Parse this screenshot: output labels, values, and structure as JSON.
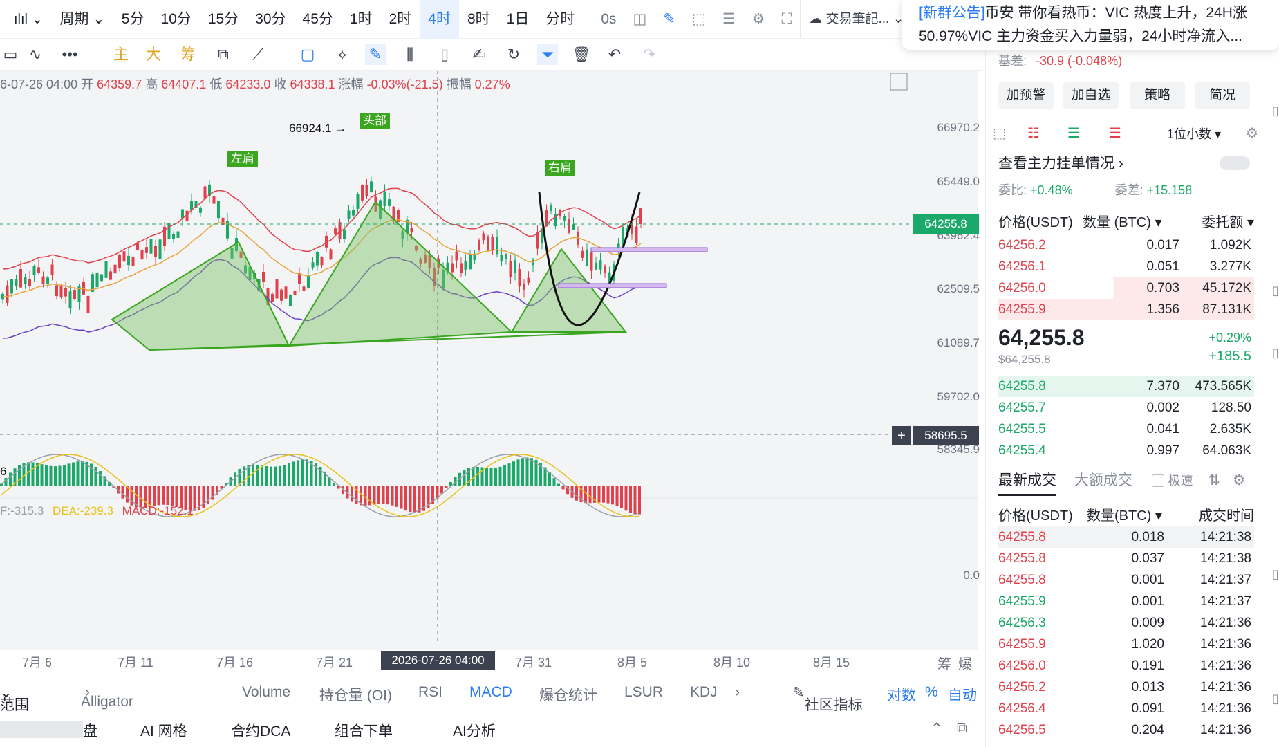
{
  "topbar": {
    "period_label": "周期",
    "intervals": [
      "5分",
      "10分",
      "15分",
      "30分",
      "45分",
      "1时",
      "2时",
      "4时",
      "8时",
      "1日",
      "分时"
    ],
    "active_interval": "4时",
    "countdown": "0s",
    "notes_label": "交易筆記..."
  },
  "toolbar2": {
    "main": "主",
    "big": "大",
    "chip": "筹"
  },
  "ohlc": {
    "datetime": "6-07-26 04:00",
    "open_label": "开",
    "open": "64359.7",
    "high_label": "高",
    "high": "64407.1",
    "low_label": "低",
    "low": "64233.0",
    "close_label": "收",
    "close": "64338.1",
    "change_label": "涨幅",
    "change": "-0.03%(-21.5)",
    "amp_label": "振幅",
    "amp": "0.27%"
  },
  "chart_data": {
    "type": "candlestick",
    "y_ticks": [
      "66970.2",
      "65449.0",
      "63962.4",
      "62509.5",
      "61089.7",
      "59702.0",
      "58345.9"
    ],
    "current_price_tag": "64255.8",
    "crosshair_price_tag": "58695.5",
    "crosshair_date_tag": "2026-07-26 04:00",
    "x_ticks": [
      "7月 6",
      "7月 11",
      "7月 16",
      "7月 21",
      "7月 31",
      "8月 5",
      "8月 10",
      "8月 15"
    ],
    "annotations": {
      "high_marker": "66924.1 →",
      "left_shoulder": "左肩",
      "head": "头部",
      "right_shoulder": "右肩",
      "low_marker": "6"
    },
    "macd": {
      "dif": "F:-315.3",
      "dea": "DEA:-239.3",
      "macd": "MACD:-152.1",
      "zero": "0.0"
    },
    "corner_labels": [
      "筹",
      "爆"
    ]
  },
  "bottom_tabs": {
    "range": "范围",
    "alligator": "Alligator",
    "items": [
      "Volume",
      "持仓量 (OI)",
      "RSI",
      "MACD",
      "爆仓统计",
      "LSUR",
      "KDJ"
    ],
    "active": "MACD",
    "community": "社区指标",
    "log": "对数",
    "pct": "%",
    "auto": "自动"
  },
  "footer": {
    "items": [
      "盘",
      "AI 网格",
      "合约DCA",
      "组合下单",
      "AI分析"
    ]
  },
  "notification": {
    "line1_tag": "[新群公告]",
    "line1": "币安 带你看热币：VIC 热度上升，24H涨",
    "line2": "50.97%VIC 主力资金买入力量弱，24小时净流入..."
  },
  "right_panel": {
    "basis_label": "基差:",
    "basis_value": "-30.9 (-0.048%)",
    "buttons": [
      "加预警",
      "加自选",
      "策略",
      "简况"
    ],
    "decimals": "1位小数",
    "main_orders": "查看主力挂单情况",
    "weibi_label": "委比:",
    "weibi": "+0.48%",
    "weicha_label": "委差:",
    "weicha": "+15.158",
    "ob_headers": {
      "price": "价格(USDT)",
      "qty": "数量 (BTC)",
      "amount": "委托额"
    },
    "asks": [
      {
        "p": "64256.2",
        "q": "0.017",
        "t": "1.092K"
      },
      {
        "p": "64256.1",
        "q": "0.051",
        "t": "3.277K"
      },
      {
        "p": "64256.0",
        "q": "0.703",
        "t": "45.172K"
      },
      {
        "p": "64255.9",
        "q": "1.356",
        "t": "87.131K"
      }
    ],
    "last_price": "64,255.8",
    "last_usd": "$64,255.8",
    "last_pct": "+0.29%",
    "last_chg": "+185.5",
    "bids": [
      {
        "p": "64255.8",
        "q": "7.370",
        "t": "473.565K"
      },
      {
        "p": "64255.7",
        "q": "0.002",
        "t": "128.50"
      },
      {
        "p": "64255.5",
        "q": "0.041",
        "t": "2.635K"
      },
      {
        "p": "64255.4",
        "q": "0.997",
        "t": "64.063K"
      }
    ],
    "trades_tab": "最新成交",
    "big_trades_tab": "大额成交",
    "fast_label": "极速",
    "trade_headers": {
      "price": "价格(USDT)",
      "qty": "数量(BTC)",
      "time": "成交时间"
    },
    "trades": [
      {
        "p": "64255.8",
        "q": "0.018",
        "t": "14:21:38",
        "side": "red"
      },
      {
        "p": "64255.8",
        "q": "0.037",
        "t": "14:21:38",
        "side": "red"
      },
      {
        "p": "64255.8",
        "q": "0.001",
        "t": "14:21:37",
        "side": "red"
      },
      {
        "p": "64255.9",
        "q": "0.001",
        "t": "14:21:37",
        "side": "green"
      },
      {
        "p": "64256.3",
        "q": "0.009",
        "t": "14:21:36",
        "side": "green"
      },
      {
        "p": "64255.9",
        "q": "1.020",
        "t": "14:21:36",
        "side": "red"
      },
      {
        "p": "64256.0",
        "q": "0.191",
        "t": "14:21:36",
        "side": "red"
      },
      {
        "p": "64256.2",
        "q": "0.013",
        "t": "14:21:36",
        "side": "red"
      },
      {
        "p": "64256.4",
        "q": "0.091",
        "t": "14:21:36",
        "side": "red"
      },
      {
        "p": "64256.5",
        "q": "0.204",
        "t": "14:21:36",
        "side": "red"
      }
    ]
  }
}
